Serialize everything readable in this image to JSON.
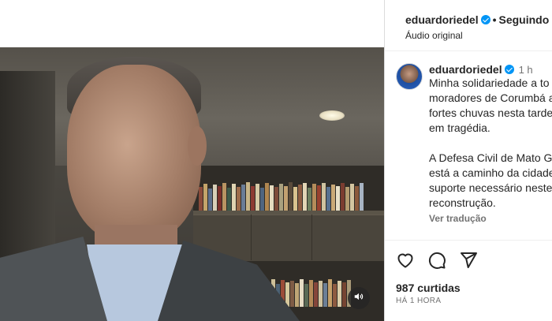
{
  "header": {
    "username": "eduardoriedel",
    "follow_label": "Seguindo",
    "separator": "•",
    "audio": "Áudio original"
  },
  "caption": {
    "username": "eduardoriedel",
    "time": "1 h",
    "lines": [
      "Minha solidariedade a to",
      "moradores de Corumbá a",
      "fortes chuvas nesta tarde",
      "em tragédia.",
      "",
      "A Defesa Civil de Mato G",
      "está a caminho da cidade",
      "suporte necessário neste",
      "reconstrução."
    ],
    "translate_label": "Ver tradução"
  },
  "actions": {
    "like_icon": "heart-icon",
    "comment_icon": "comment-icon",
    "share_icon": "share-icon"
  },
  "stats": {
    "likes": "987 curtidas",
    "date": "HÁ 1 HORA"
  },
  "video": {
    "mute_icon": "speaker-icon"
  },
  "colors": {
    "verified": "#0095f6",
    "text": "#262626",
    "secondary": "#737373",
    "border": "#dbdbdb"
  }
}
